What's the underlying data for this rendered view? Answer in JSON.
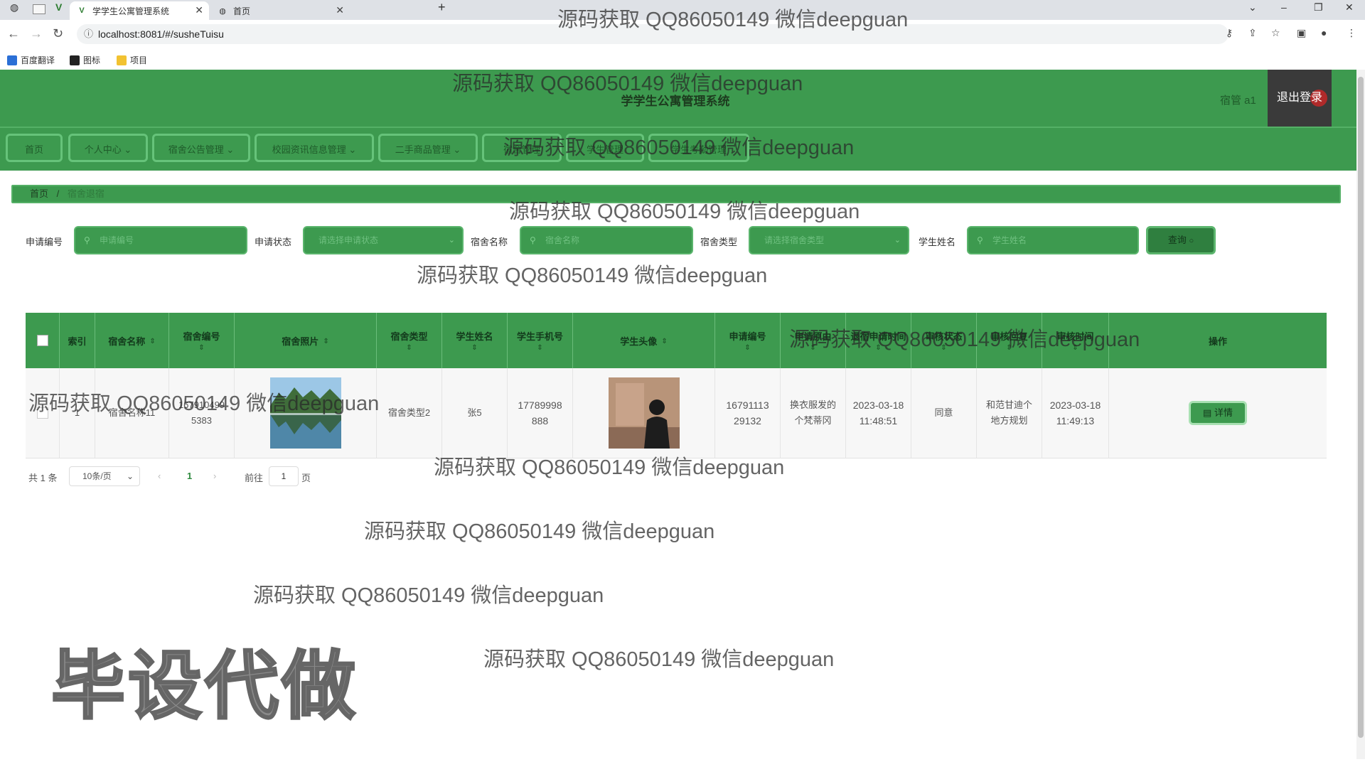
{
  "browser": {
    "tabs": [
      {
        "title": "学学生公寓管理系统",
        "active": true
      },
      {
        "title": "首页",
        "active": false
      }
    ],
    "url": "localhost:8081/#/susheTuisu",
    "bookmarks": [
      "百度翻译",
      "图标",
      "项目"
    ]
  },
  "header": {
    "system_title": "学学生公寓管理系统",
    "user_label": "宿管 a1",
    "logout_label": "退出登录"
  },
  "menu": {
    "items": [
      "首页",
      "个人中心",
      "宿舍公告管理",
      "校园资讯信息管理",
      "二手商品管理",
      "宿舍管理",
      "学生管理",
      "学生考勤管理"
    ]
  },
  "breadcrumb": {
    "home": "首页",
    "separator": "/",
    "current": "宿舍退宿"
  },
  "search": {
    "fields": [
      {
        "label": "申请编号",
        "placeholder": "申请编号"
      },
      {
        "label": "申请状态",
        "placeholder": "请选择申请状态"
      },
      {
        "label": "宿舍名称",
        "placeholder": "宿舍名称"
      },
      {
        "label": "宿舍类型",
        "placeholder": "请选择宿舍类型"
      },
      {
        "label": "学生姓名",
        "placeholder": "学生姓名"
      }
    ],
    "query_label": "查询"
  },
  "table": {
    "columns": [
      "索引",
      "宿舍名称",
      "宿舍编号",
      "宿舍照片",
      "宿舍类型",
      "学生姓名",
      "学生手机号",
      "学生头像",
      "申请编号",
      "申请原由",
      "退宿申请时间",
      "审核状态",
      "审核回复",
      "审核时间",
      "操作"
    ],
    "rows": [
      {
        "index": "1",
        "dorm_name": "宿舍名称11",
        "dorm_no": "1679104995383",
        "dorm_type": "宿舍类型2",
        "student_name": "张5",
        "phone": "17789998888",
        "apply_no": "1679111329132",
        "reason": "换衣服发的个梵蒂冈",
        "apply_time": "2023-03-18 11:48:51",
        "status": "同意",
        "reply": "和范甘迪个地方规划",
        "review_time": "2023-03-18 11:49:13",
        "action": "详情"
      }
    ]
  },
  "pagination": {
    "total": "共 1 条",
    "page_size": "10条/页",
    "current_page": "1",
    "goto_label": "前往",
    "goto_value": "1",
    "page_suffix": "页"
  },
  "watermark": {
    "text": "源码获取 QQ86050149 微信deepguan",
    "big": "毕设代做"
  },
  "colors": {
    "primary_green": "#3d9a4f",
    "border_green": "#5bb56d"
  }
}
